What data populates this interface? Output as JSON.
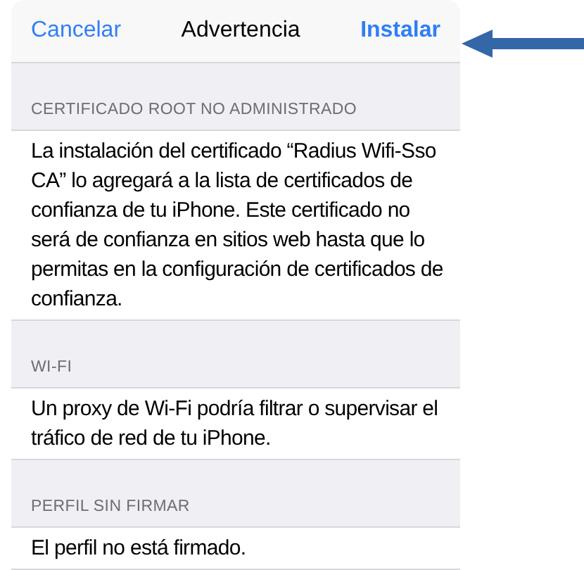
{
  "nav_bar": {
    "cancel": "Cancelar",
    "title": "Advertencia",
    "install": "Instalar"
  },
  "sections": [
    {
      "header": "CERTIFICADO ROOT NO ADMINISTRADO",
      "text": "La instalación del certificado “Radius Wifi-Sso CA” lo agregará a la lista de certificados de confianza de tu iPhone. Este certificado no será de confianza en sitios web hasta que lo permitas en la configuración de certificados de confianza."
    },
    {
      "header": "WI-FI",
      "text": "Un proxy de Wi-Fi podría filtrar o supervisar el tráfico de red de tu iPhone."
    },
    {
      "header": "PERFIL SIN FIRMAR",
      "text": "El perfil no está firmado."
    }
  ]
}
